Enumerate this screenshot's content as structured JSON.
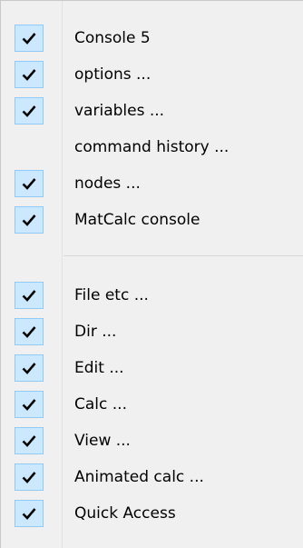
{
  "menu": {
    "items": [
      {
        "label": "Console 5",
        "checked": true
      },
      {
        "label": "options ...",
        "checked": true
      },
      {
        "label": "variables ...",
        "checked": true
      },
      {
        "label": "command history ...",
        "checked": false
      },
      {
        "label": "nodes ...",
        "checked": true
      },
      {
        "label": "MatCalc console",
        "checked": true
      },
      {
        "label": "File etc ...",
        "checked": true
      },
      {
        "label": "Dir ...",
        "checked": true
      },
      {
        "label": "Edit ...",
        "checked": true
      },
      {
        "label": "Calc ...",
        "checked": true
      },
      {
        "label": "View ...",
        "checked": true
      },
      {
        "label": "Animated calc ...",
        "checked": true
      },
      {
        "label": "Quick Access",
        "checked": true
      }
    ]
  },
  "colors": {
    "check_bg": "#cce8ff",
    "check_border": "#90c8f6",
    "menu_bg": "#f0f0f0",
    "check_mark": "#000000"
  }
}
